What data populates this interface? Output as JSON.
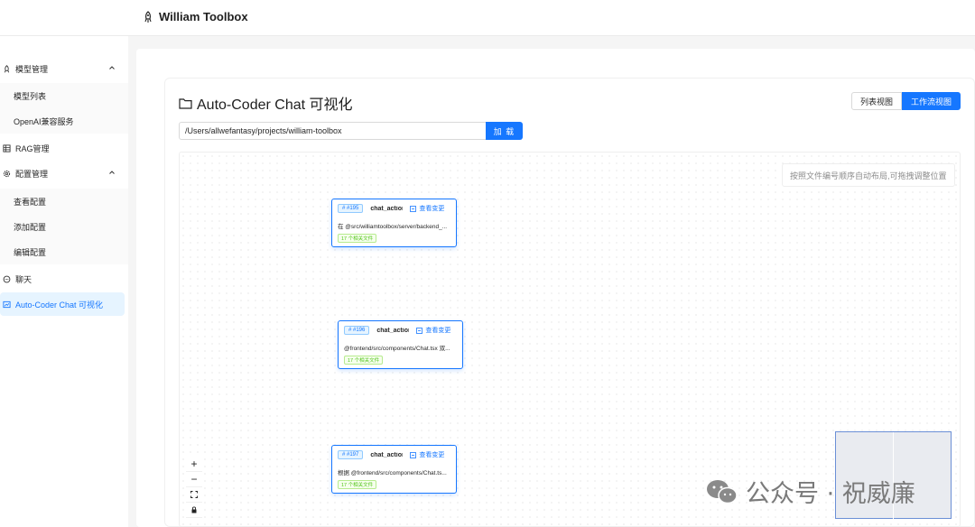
{
  "app": {
    "title": "William Toolbox"
  },
  "sidebar": {
    "items": [
      {
        "label": "模型管理",
        "icon": "rocket-icon"
      },
      {
        "label": "模型列表"
      },
      {
        "label": "OpenAI兼容服务"
      },
      {
        "label": "RAG管理",
        "icon": "database-icon"
      },
      {
        "label": "配置管理",
        "icon": "gear-icon"
      },
      {
        "label": "查看配置"
      },
      {
        "label": "添加配置"
      },
      {
        "label": "编辑配置"
      },
      {
        "label": "聊天",
        "icon": "chat-icon"
      },
      {
        "label": "Auto-Coder Chat 可视化",
        "icon": "chart-icon"
      }
    ]
  },
  "main": {
    "title": "Auto-Coder Chat 可视化",
    "view_toggle": {
      "list": "列表视图",
      "workflow": "工作流视图"
    },
    "path_input": {
      "value": "/Users/allwefantasy/projects/william-toolbox"
    },
    "load_button": "加 载",
    "hint": "按照文件编号顺序自动布局,可拖拽调整位置"
  },
  "nodes": [
    {
      "id": "# #195",
      "action": "chat_action",
      "changes": "查看变更",
      "query": "在 @src/williamtoolbox/server/backend_...",
      "files": "17 个相关文件"
    },
    {
      "id": "# #196",
      "action": "chat_action",
      "changes": "查看变更",
      "query": "@frontend/src/components/Chat.tsx 双...",
      "files": "17 个相关文件"
    },
    {
      "id": "# #197",
      "action": "chat_action",
      "changes": "查看变更",
      "query": "根据 @frontend/src/components/Chat.ts...",
      "files": "17 个相关文件"
    }
  ],
  "controls": {
    "zoom_in": "+",
    "zoom_out": "−"
  },
  "watermark": {
    "text": "公众号 · 祝威廉"
  }
}
